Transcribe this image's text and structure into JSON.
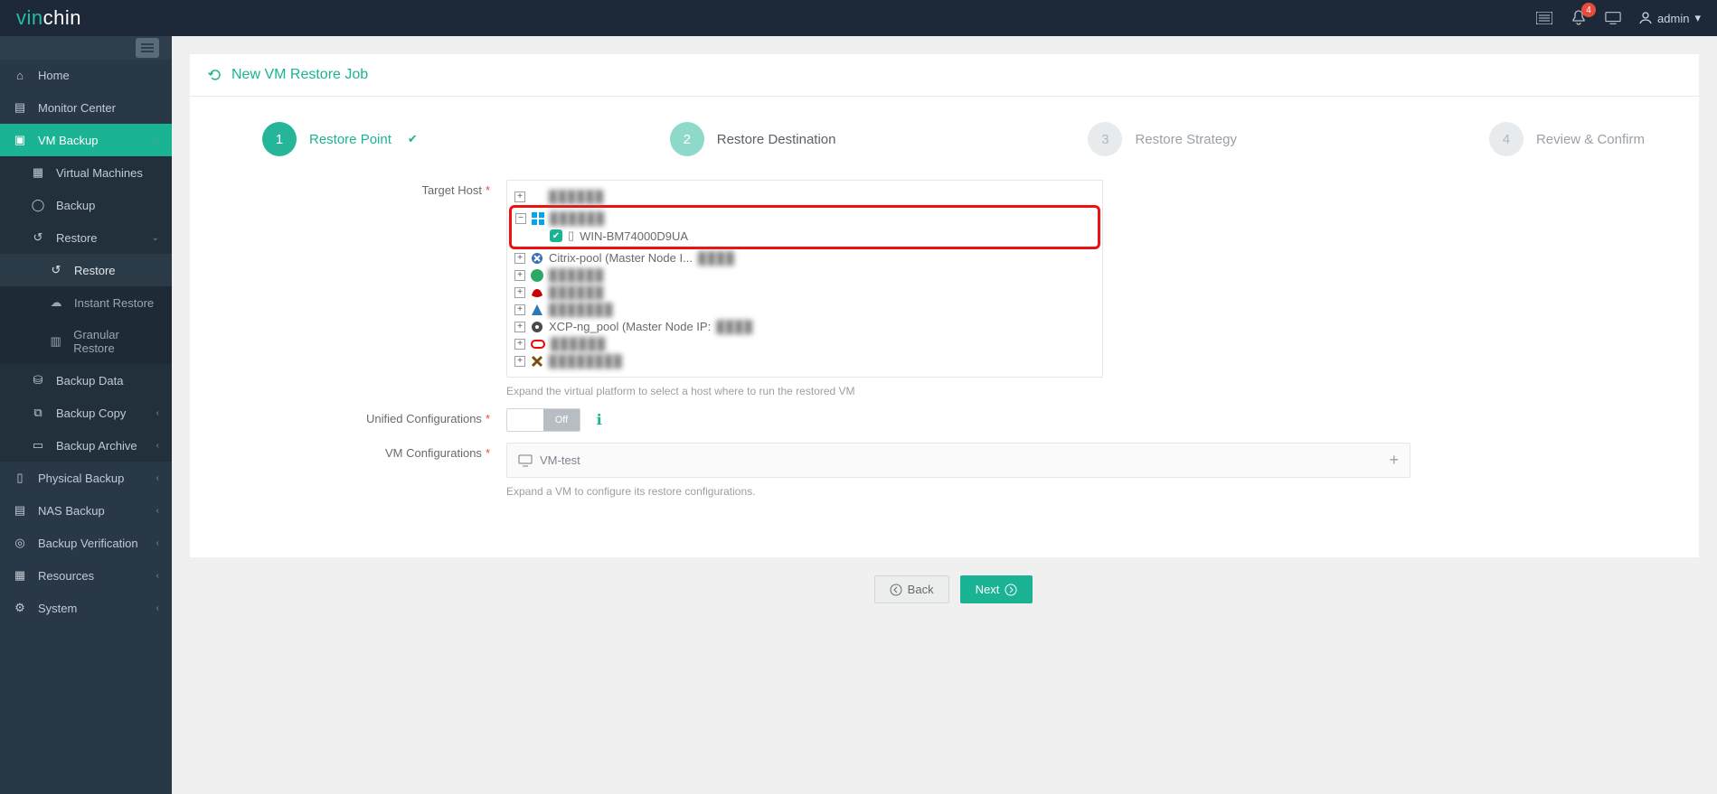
{
  "brand": {
    "part1": "vin",
    "part2": "chin"
  },
  "notifications": {
    "count": "4"
  },
  "user": {
    "name": "admin"
  },
  "sidebar": {
    "home": "Home",
    "monitor": "Monitor Center",
    "vmbackup": {
      "label": "VM Backup",
      "vms": "Virtual Machines",
      "backup": "Backup",
      "restore": {
        "label": "Restore",
        "restore": "Restore",
        "instant": "Instant Restore",
        "granular": "Granular Restore"
      },
      "backupdata": "Backup Data",
      "backupcopy": "Backup Copy",
      "backuparchive": "Backup Archive"
    },
    "physical": "Physical Backup",
    "nas": "NAS Backup",
    "verify": "Backup Verification",
    "resources": "Resources",
    "system": "System"
  },
  "page": {
    "title": "New VM Restore Job",
    "steps": {
      "s1": {
        "num": "1",
        "label": "Restore Point"
      },
      "s2": {
        "num": "2",
        "label": "Restore Destination"
      },
      "s3": {
        "num": "3",
        "label": "Restore Strategy"
      },
      "s4": {
        "num": "4",
        "label": "Review & Confirm"
      }
    },
    "form": {
      "target_host": {
        "label": "Target Host",
        "help": "Expand the virtual platform to select a host where to run the restored VM"
      },
      "unified": {
        "label": "Unified Configurations",
        "off": "Off"
      },
      "vmconfig": {
        "label": "VM Configurations",
        "help": "Expand a VM to configure its restore configurations.",
        "vm": "VM-test"
      }
    },
    "tree": {
      "selected_host": "WIN-BM74000D9UA",
      "citrix": "Citrix-pool (Master Node I...",
      "xcp": "XCP-ng_pool (Master Node IP:"
    },
    "buttons": {
      "back": "Back",
      "next": "Next"
    }
  },
  "colors": {
    "vmware": "#6fbf44",
    "hyperv": "#00a4ef",
    "citrix": "#3a6fb7",
    "green": "#2fa866",
    "redhat": "#cc0000",
    "azure": "#2a7ab9",
    "xcp": "#4a4a4a",
    "oracle": "#f80000",
    "nutanix": "#7b500f"
  }
}
